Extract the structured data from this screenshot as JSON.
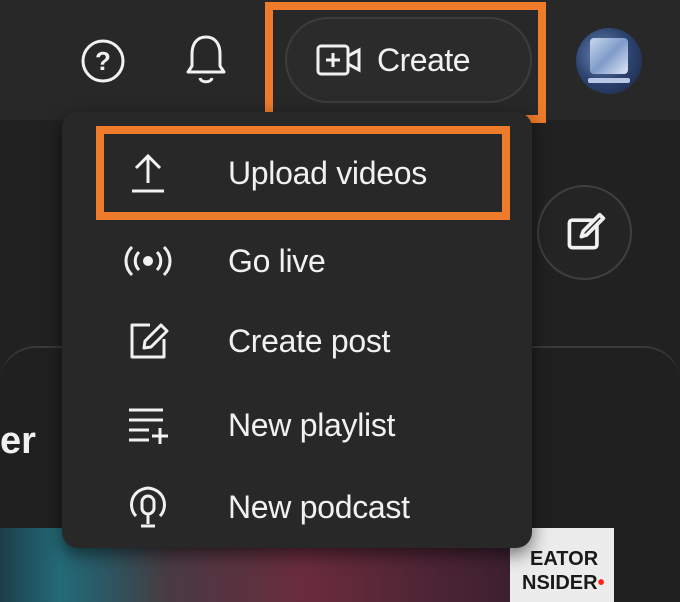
{
  "header": {
    "create_label": "Create",
    "icons": [
      "help-icon",
      "bell-icon",
      "create-video-icon",
      "avatar"
    ]
  },
  "menu": {
    "items": [
      {
        "label": "Upload videos",
        "icon": "upload-icon"
      },
      {
        "label": "Go live",
        "icon": "broadcast-icon"
      },
      {
        "label": "Create post",
        "icon": "edit-post-icon"
      },
      {
        "label": "New playlist",
        "icon": "playlist-add-icon"
      },
      {
        "label": "New podcast",
        "icon": "podcast-icon"
      }
    ]
  },
  "background": {
    "partial_title": "er",
    "thumbnail_text_line1": "EATOR",
    "thumbnail_text_line2": "NSIDER"
  },
  "colors": {
    "highlight": "#ee7b2a",
    "menu_bg": "#282828",
    "page_bg": "#212121",
    "text": "#f1f1f1"
  }
}
